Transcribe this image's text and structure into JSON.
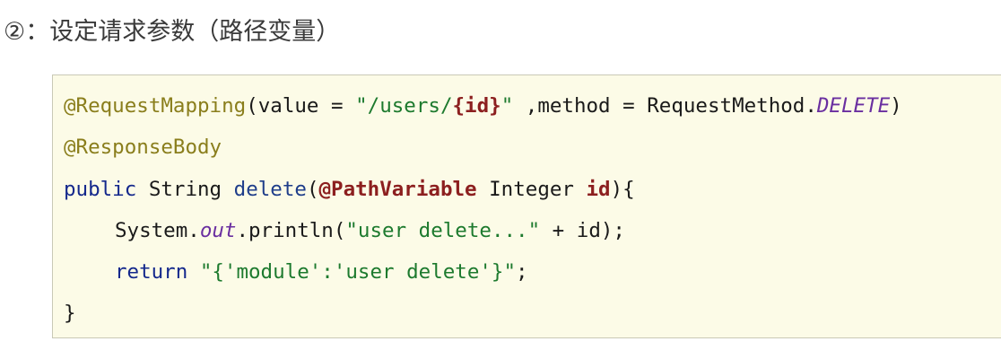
{
  "heading": "②：设定请求参数（路径变量）",
  "code": {
    "l1": {
      "ann": "@RequestMapping",
      "p1": "(value = ",
      "s1": "\"/users/",
      "var": "{id}",
      "s2": "\"",
      "p2": " ,method = RequestMethod.",
      "const": "DELETE",
      "p3": ")"
    },
    "l2": {
      "ann": "@ResponseBody"
    },
    "l3": {
      "kw": "public",
      "p1": " String ",
      "name": "delete",
      "p2": "(",
      "ann": "@PathVariable",
      "p3": " Integer ",
      "param": "id",
      "p4": "){"
    },
    "l4": {
      "p1": "System.",
      "field": "out",
      "p2": ".println(",
      "str": "\"user delete...\"",
      "p3": " + id);"
    },
    "l5": {
      "kw": "return",
      "p1": " ",
      "str": "\"{'module':'user delete'}\"",
      "p2": ";"
    },
    "l6": {
      "p1": "}"
    }
  }
}
